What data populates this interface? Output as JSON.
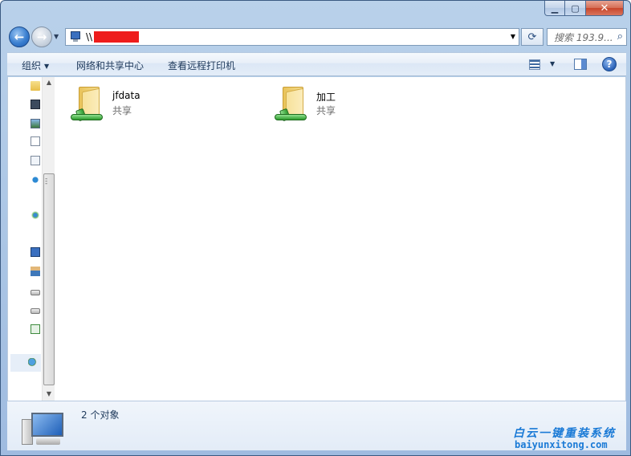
{
  "window": {
    "caption_min": "▁",
    "caption_max": "▢",
    "caption_close": "✕"
  },
  "address": {
    "prefix": "\\\\",
    "dropdown": "▼",
    "refresh": "⟳"
  },
  "search": {
    "placeholder": "搜索 193.9...",
    "icon": "⌕"
  },
  "toolbar": {
    "organize": "组织",
    "network_center": "网络和共享中心",
    "remote_printers": "查看远程打印机",
    "help": "?"
  },
  "items": [
    {
      "name": "jfdata",
      "status": "共享"
    },
    {
      "name": "加工",
      "status": "共享"
    }
  ],
  "details": {
    "count_text": "2 个对象"
  },
  "watermark": {
    "cn": "白云一键重装系统",
    "en": "baiyunxitong.com"
  },
  "colors": {
    "accent": "#1a7ad6",
    "redaction": "#ee1c1c",
    "frame": "#a9c4e4"
  }
}
